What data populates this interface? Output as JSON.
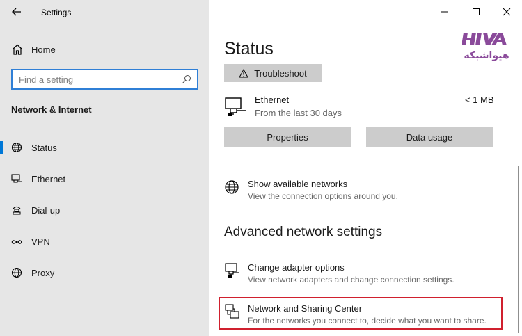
{
  "window": {
    "title": "Settings"
  },
  "sidebar": {
    "home_label": "Home",
    "search_placeholder": "Find a setting",
    "section_label": "Network & Internet",
    "items": [
      {
        "label": "Status",
        "icon": "globe-icon",
        "active": true
      },
      {
        "label": "Ethernet",
        "icon": "ethernet-icon",
        "active": false
      },
      {
        "label": "Dial-up",
        "icon": "dialup-icon",
        "active": false
      },
      {
        "label": "VPN",
        "icon": "vpn-icon",
        "active": false
      },
      {
        "label": "Proxy",
        "icon": "globe-icon",
        "active": false
      }
    ]
  },
  "main": {
    "title": "Status",
    "troubleshoot_label": "Troubleshoot",
    "ethernet": {
      "name": "Ethernet",
      "subtitle": "From the last 30 days",
      "usage": "< 1 MB"
    },
    "properties_label": "Properties",
    "data_usage_label": "Data usage",
    "show_networks": {
      "title": "Show available networks",
      "subtitle": "View the connection options around you."
    },
    "advanced_title": "Advanced network settings",
    "adapter": {
      "title": "Change adapter options",
      "subtitle": "View network adapters and change connection settings."
    },
    "sharing": {
      "title": "Network and Sharing Center",
      "subtitle": "For the networks you connect to, decide what you want to share."
    }
  },
  "logo": {
    "text": "هیواشبکه",
    "mark": "HIVA"
  },
  "colors": {
    "accent": "#0078d7",
    "highlight": "#d0202e",
    "sidebar_bg": "#e6e6e6",
    "button_bg": "#cccccc",
    "logo": "#8a4a9a"
  }
}
